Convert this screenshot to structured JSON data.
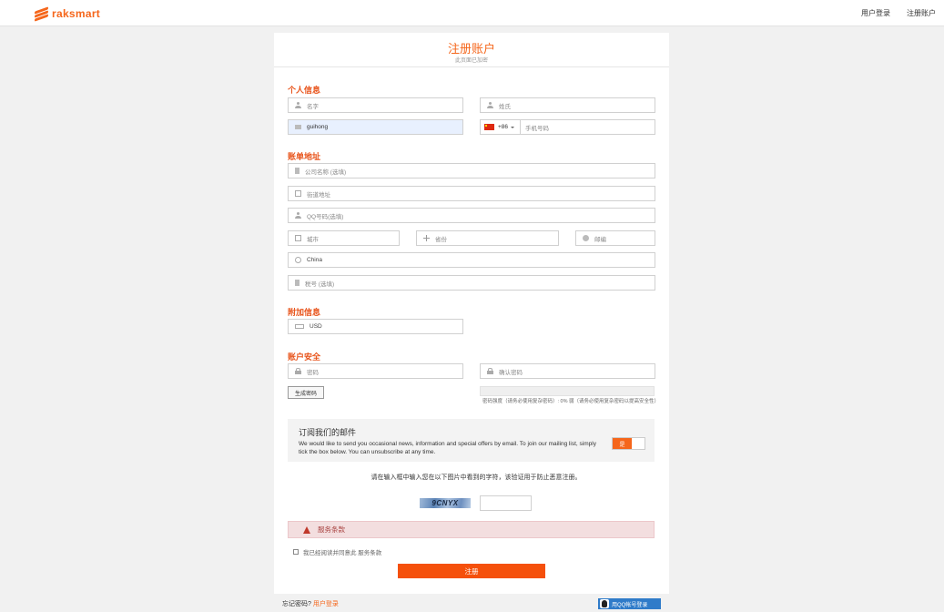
{
  "header": {
    "brand": "raksmart",
    "nav": [
      "用户登录",
      "注册账户"
    ]
  },
  "form": {
    "title": "注册账户",
    "subtitle": "此页面已加密",
    "sections": {
      "personal": "个人信息",
      "billing": "账单地址",
      "additional": "附加信息",
      "security": "账户安全"
    },
    "personal": {
      "first_name_placeholder": "名字",
      "last_name_placeholder": "姓氏",
      "email_value": "guihong",
      "country_code": "+86",
      "phone_placeholder": "手机号码"
    },
    "billing": {
      "company_placeholder": "公司名称 (选填)",
      "street_placeholder": "街道地址",
      "qq_placeholder": "QQ号码(选填)",
      "city_placeholder": "城市",
      "province_placeholder": "省份",
      "zip_placeholder": "邮编",
      "country_value": "China",
      "tax_placeholder": "税号 (选填)"
    },
    "additional": {
      "currency_value": "USD"
    },
    "security": {
      "password_placeholder": "密码",
      "confirm_placeholder": "确认密码",
      "generate_label": "生成密码",
      "strength_text": "密码强度（请务必使用复杂密码）: 0% 弱（请务必使用复杂密码以提高安全性）"
    },
    "subscribe": {
      "title": "订阅我们的邮件",
      "description": "We would like to send you occasional news, information and special offers by email. To join our mailing list, simply tick the box below. You can unsubscribe at any time.",
      "toggle_label": "是"
    },
    "captcha": {
      "instruction": "请在输入框中输入您在以下图片中看到的字符，该验证用于防止恶意注册。",
      "image_text": "9CNYX"
    },
    "tos": {
      "label": "服务条款",
      "agree_text": "我已经阅读并同意此 服务条款"
    },
    "submit_label": "注册"
  },
  "footer": {
    "forgot_text": "忘记密码?",
    "login_link": "用户登录",
    "qq_login": "用QQ帐号登录"
  },
  "colors": {
    "brand": "#f5661b",
    "submit": "#f5500b",
    "qq": "#2f7bc9",
    "tos_bg": "#f3dedf"
  }
}
